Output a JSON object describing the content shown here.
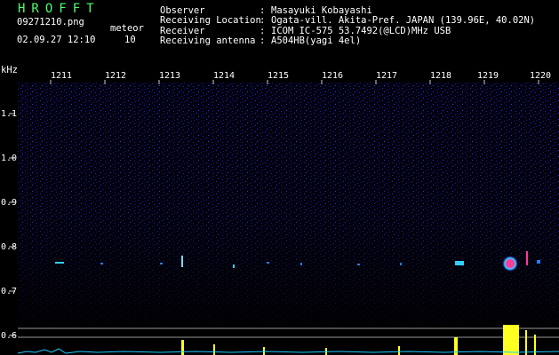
{
  "app": {
    "title": "HROFFT",
    "file_name": "09271210.png",
    "datetime": "02.09.27 12:10",
    "meteor_label": "meteor",
    "meteor_count": "10"
  },
  "header": {
    "rows": [
      {
        "label": "Observer",
        "value": "Masayuki Kobayashi"
      },
      {
        "label": "Receiving Location",
        "value": "Ogata-vill. Akita-Pref. JAPAN (139.96E, 40.02N)"
      },
      {
        "label": "Receiver",
        "value": "ICOM IC-575 53.7492(@LCD)MHz USB"
      },
      {
        "label": "Receiving antenna",
        "value": "A504HB(yagi 4el)"
      }
    ],
    "separator": ":"
  },
  "axis": {
    "unit": "kHz",
    "time_ticks": [
      "1211",
      "1212",
      "1213",
      "1214",
      "1215",
      "1216",
      "1217",
      "1218",
      "1219",
      "1220"
    ],
    "freq_ticks": [
      "1.1",
      "1.0",
      "0.9",
      "0.8",
      "0.7",
      "0.6"
    ]
  },
  "colors": {
    "title": "#4cff6e",
    "background_noise": "#2a2ad8",
    "meteor_hot": "#ff3a9a",
    "meteor_warm": "#34d0ff",
    "level_bars": "#ffff22",
    "noise_floor": "#1fc8ff"
  }
}
